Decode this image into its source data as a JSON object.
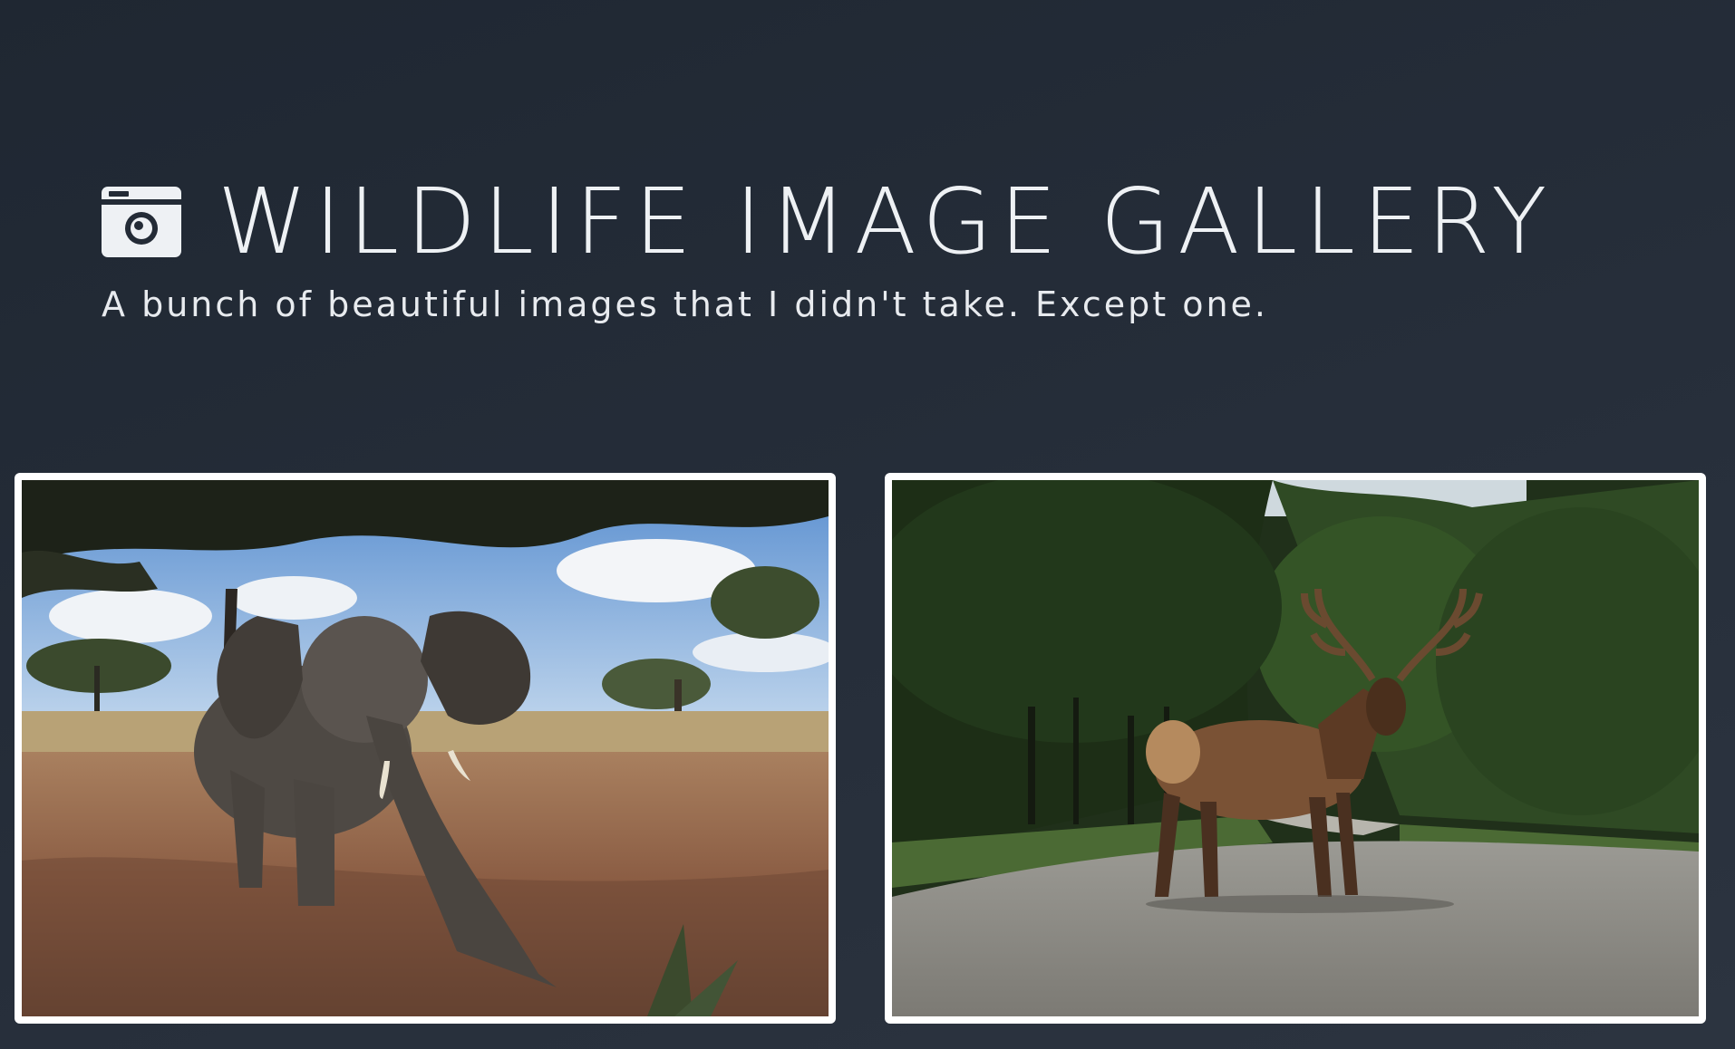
{
  "header": {
    "title": "WILDLIFE IMAGE GALLERY",
    "subtitle": "A bunch of beautiful images that I didn't take. Except one.",
    "icon": "camera-icon"
  },
  "gallery": {
    "images": [
      {
        "subject": "elephant"
      },
      {
        "subject": "elk"
      }
    ]
  },
  "colors": {
    "background": "#232b36",
    "text": "#eef1f4",
    "card_border": "#ffffff"
  }
}
